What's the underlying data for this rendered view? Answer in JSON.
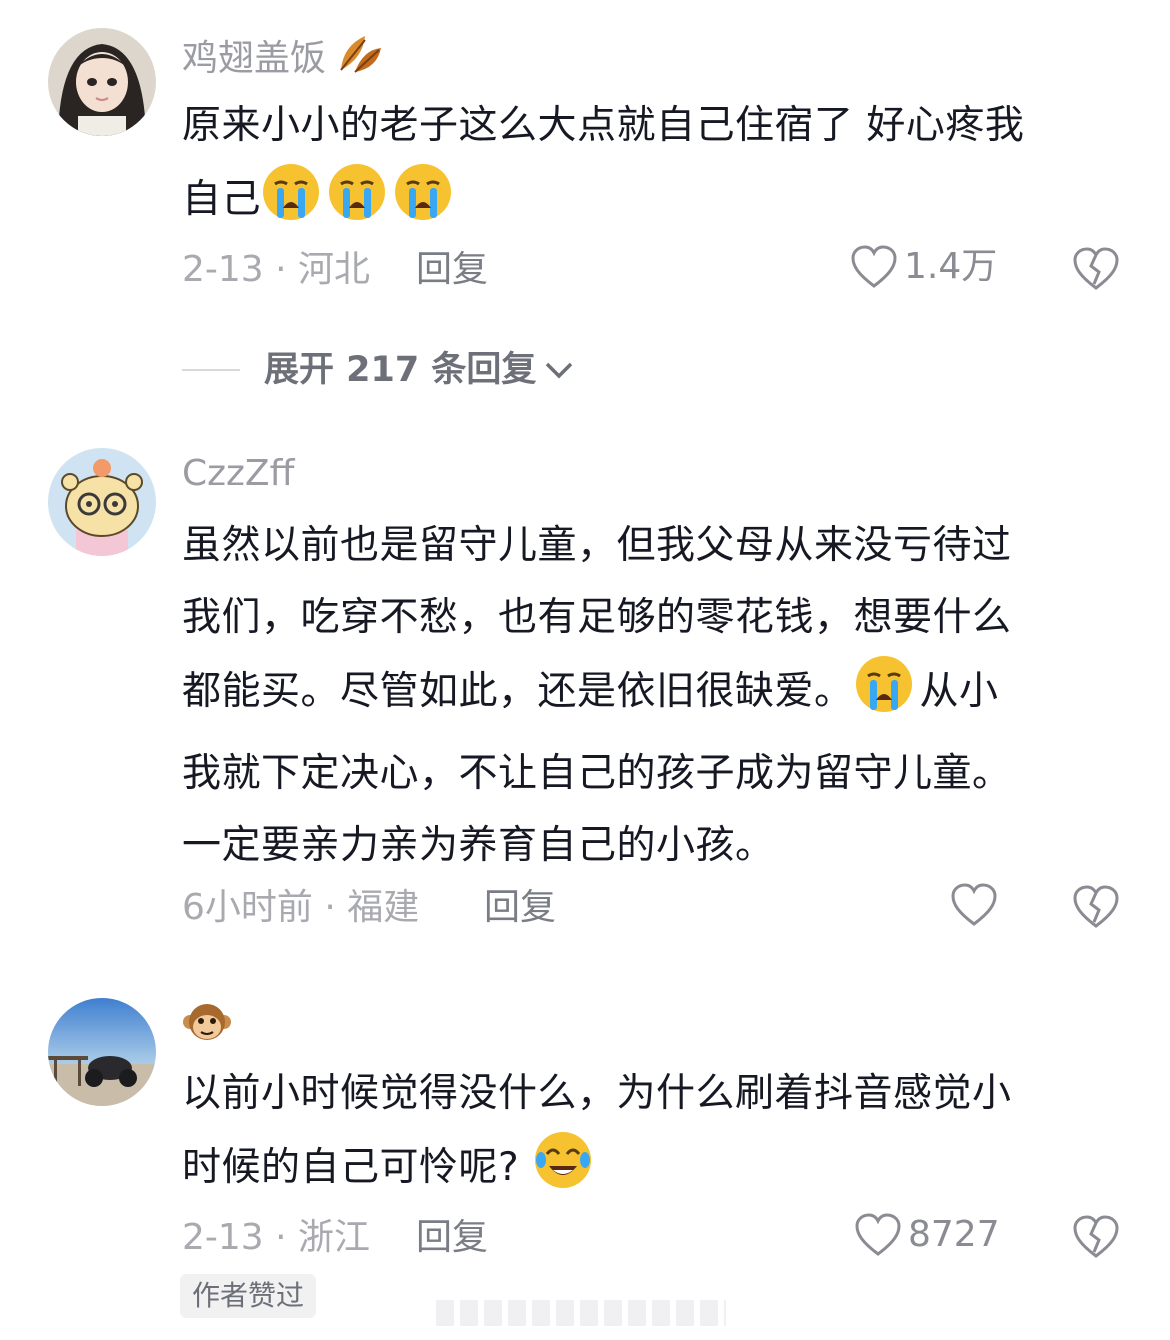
{
  "comments": [
    {
      "username": "鸡翅盖饭",
      "username_emoji": "fallen-leaf-icon",
      "lines": [
        "原来小小的老子这么大点就自己住宿了 好心疼我",
        "自己"
      ],
      "emojis": [
        "crying-face-icon",
        "crying-face-icon",
        "crying-face-icon"
      ],
      "meta": "2-13 · 河北",
      "reply_label": "回复",
      "like_count": "1.4万"
    },
    {
      "username": "CzzZff",
      "lines": [
        "虽然以前也是留守儿童，但我父母从来没亏待过",
        "我们，吃穿不愁，也有足够的零花钱，想要什么",
        "都能买。尽管如此，还是依旧很缺爱。",
        "从小",
        "我就下定决心，不让自己的孩子成为留守儿童。",
        "一定要亲力亲为养育自己的小孩。"
      ],
      "meta": "6小时前 · 福建",
      "reply_label": "回复",
      "like_count": ""
    },
    {
      "username_emoji": "monkey-face-icon",
      "lines": [
        "以前小时候觉得没什么，为什么刷着抖音感觉小",
        "时候的自己可怜呢?"
      ],
      "meta": "2-13 · 浙江",
      "reply_label": "回复",
      "like_count": "8727",
      "badge": "作者赞过"
    }
  ],
  "expand_label": "展开 217 条回复",
  "colors": {
    "text": "#161823",
    "secondary": "#a9aab0",
    "emoji_yellow": "#f7c230",
    "tears": "#3aa7f2"
  }
}
